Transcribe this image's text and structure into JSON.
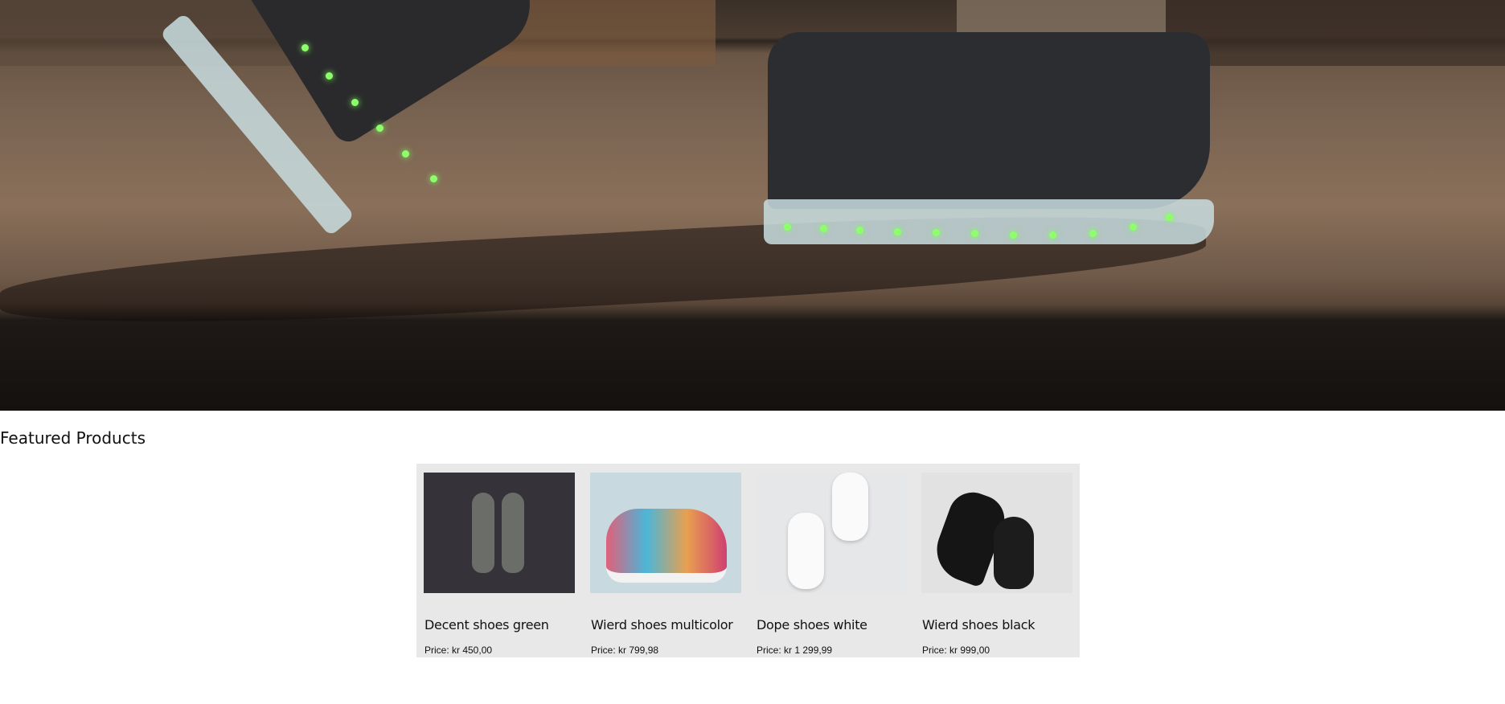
{
  "hero": {
    "image": "shoes-with-led-soles-walking"
  },
  "featured": {
    "heading": "Featured Products",
    "products": [
      {
        "title": "Decent shoes green",
        "price": "Price: kr 450,00",
        "image": "grey-sneakers-on-dark",
        "bg": "#35323a"
      },
      {
        "title": "Wierd shoes multicolor",
        "price": "Price: kr 799,98",
        "image": "multicolor-sneakers",
        "bg": "#c9d9e0"
      },
      {
        "title": "Dope shoes white",
        "price": "Price: kr 1 299,99",
        "image": "white-sneakers",
        "bg": "#e6e7e9"
      },
      {
        "title": "Wierd shoes black",
        "price": "Price: kr 999,00",
        "image": "black-dress-shoes",
        "bg": "#e2e2e2"
      }
    ]
  }
}
